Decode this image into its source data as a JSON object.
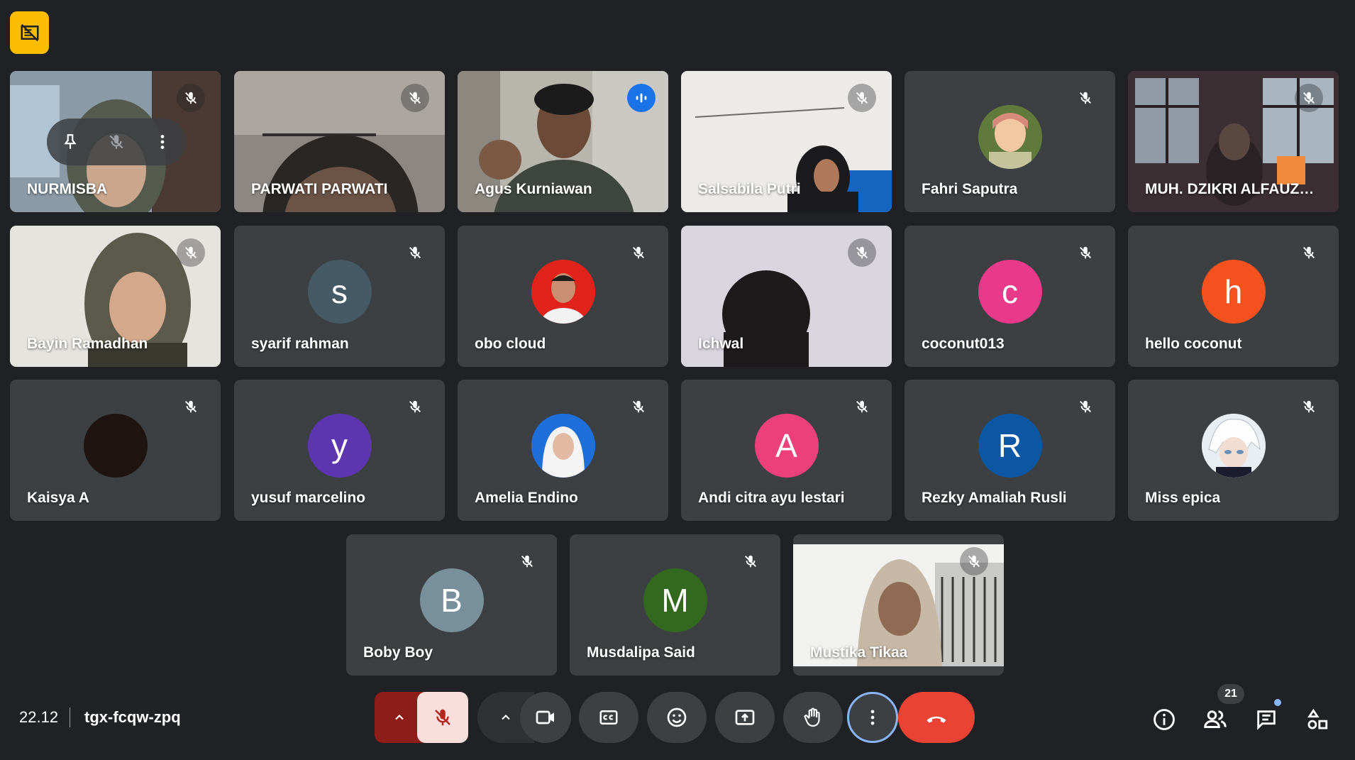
{
  "meeting": {
    "time": "22.12",
    "code": "tgx-fcqw-zpq"
  },
  "participants_count": "21",
  "participants": [
    {
      "name": "NURMISBA"
    },
    {
      "name": "PARWATI PARWATI"
    },
    {
      "name": "Agus Kurniawan"
    },
    {
      "name": "Salsabila Putri"
    },
    {
      "name": "Fahri Saputra"
    },
    {
      "name": "MUH. DZIKRI ALFAUZA..."
    },
    {
      "name": "Bayin Ramadhan"
    },
    {
      "name": "syarif rahman",
      "initial": "s",
      "color": "#455a64"
    },
    {
      "name": "obo cloud"
    },
    {
      "name": "Ichwal"
    },
    {
      "name": "coconut013",
      "initial": "c",
      "color": "#e8398a"
    },
    {
      "name": "hello coconut",
      "initial": "h",
      "color": "#f4511e"
    },
    {
      "name": "Kaisya A"
    },
    {
      "name": "yusuf marcelino",
      "initial": "y",
      "color": "#5e35b1"
    },
    {
      "name": "Amelia Endino"
    },
    {
      "name": "Andi citra ayu lestari",
      "initial": "A",
      "color": "#ec407a"
    },
    {
      "name": "Rezky Amaliah Rusli",
      "initial": "R",
      "color": "#0b57a4"
    },
    {
      "name": "Miss epica"
    },
    {
      "name": "Boby Boy",
      "initial": "B",
      "color": "#78909c"
    },
    {
      "name": "Musdalipa Said",
      "initial": "M",
      "color": "#33691e"
    },
    {
      "name": "Mustika Tikaa"
    }
  ],
  "icons": {
    "recording": "recording-off-icon",
    "mute": "mic-off-icon",
    "speaking": "speaking-icon",
    "pin": "pin-icon",
    "more": "more-vert-icon",
    "camera": "camera-icon",
    "captions": "captions-icon",
    "emoji": "emoji-icon",
    "present": "present-icon",
    "hand": "raise-hand-icon",
    "hangup": "call-end-icon",
    "info": "info-icon",
    "people": "people-icon",
    "chat": "chat-icon",
    "activities": "activities-icon"
  },
  "colors": {
    "background": "#202124",
    "tile": "#3c4043",
    "active_outline": "#8ab4f8",
    "hangup": "#ea4335",
    "mic_off_bg": "#f9dedc",
    "recording": "#fbbc04"
  }
}
